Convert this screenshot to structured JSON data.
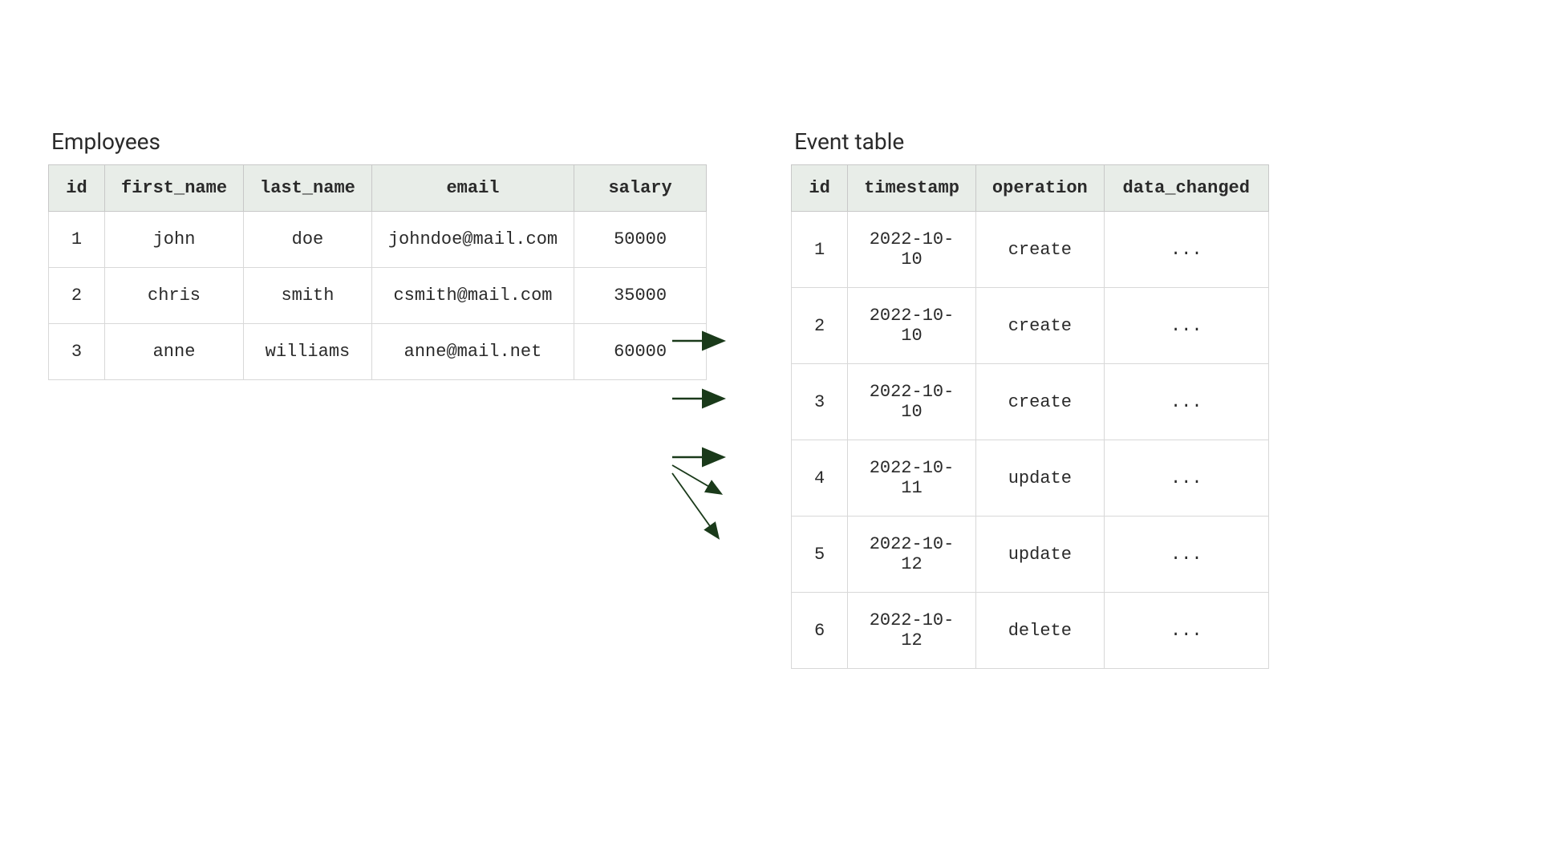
{
  "employees": {
    "title": "Employees",
    "headers": [
      "id",
      "first_name",
      "last_name",
      "email",
      "salary"
    ],
    "rows": [
      {
        "id": "1",
        "first_name": "john",
        "last_name": "doe",
        "email": "johndoe@mail.com",
        "salary": "50000"
      },
      {
        "id": "2",
        "first_name": "chris",
        "last_name": "smith",
        "email": "csmith@mail.com",
        "salary": "35000"
      },
      {
        "id": "3",
        "first_name": "anne",
        "last_name": "williams",
        "email": "anne@mail.net",
        "salary": "60000"
      }
    ]
  },
  "events": {
    "title": "Event table",
    "headers": [
      "id",
      "timestamp",
      "operation",
      "data_changed"
    ],
    "rows": [
      {
        "id": "1",
        "timestamp": "2022-10-10",
        "operation": "create",
        "data_changed": "..."
      },
      {
        "id": "2",
        "timestamp": "2022-10-10",
        "operation": "create",
        "data_changed": "..."
      },
      {
        "id": "3",
        "timestamp": "2022-10-10",
        "operation": "create",
        "data_changed": "..."
      },
      {
        "id": "4",
        "timestamp": "2022-10-11",
        "operation": "update",
        "data_changed": "..."
      },
      {
        "id": "5",
        "timestamp": "2022-10-12",
        "operation": "update",
        "data_changed": "..."
      },
      {
        "id": "6",
        "timestamp": "2022-10-12",
        "operation": "delete",
        "data_changed": "..."
      }
    ]
  }
}
